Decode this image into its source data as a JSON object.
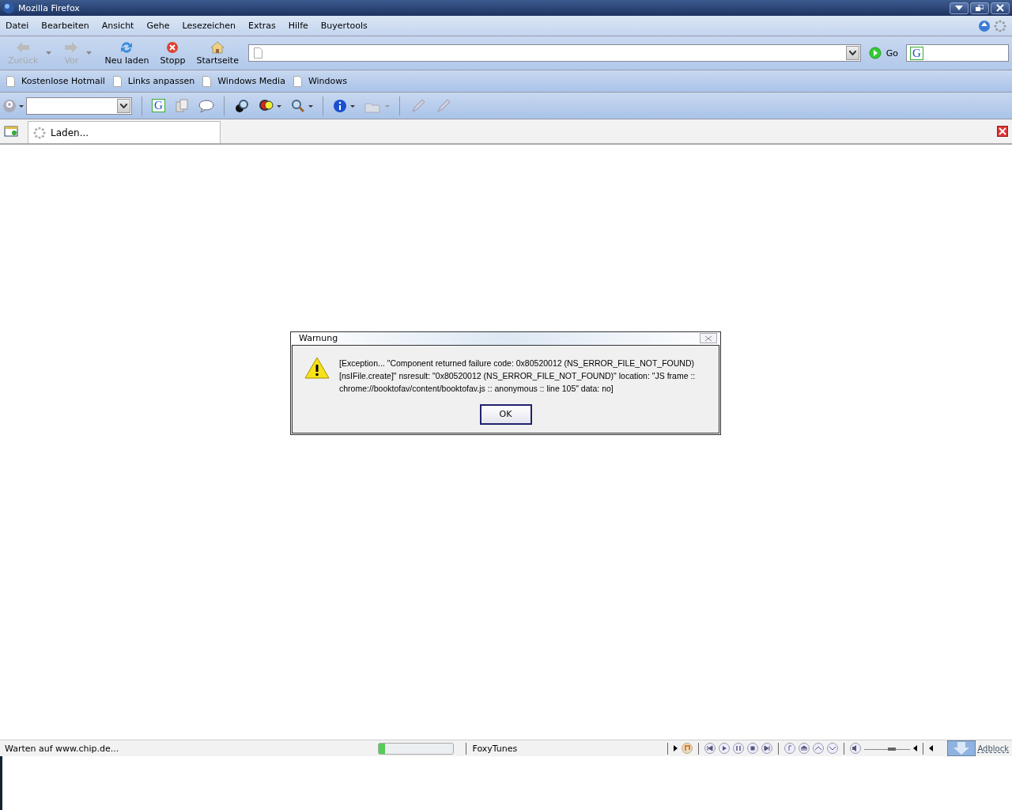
{
  "window": {
    "title": "Mozilla Firefox"
  },
  "menu": [
    "Datei",
    "Bearbeiten",
    "Ansicht",
    "Gehe",
    "Lesezeichen",
    "Extras",
    "Hilfe",
    "Buyertools"
  ],
  "nav_buttons": [
    {
      "label": "Zurück",
      "disabled": true,
      "kind": "back",
      "dropdown": true
    },
    {
      "label": "Vor",
      "disabled": true,
      "kind": "forward",
      "dropdown": true
    },
    {
      "label": "Neu laden",
      "disabled": false,
      "kind": "reload",
      "dropdown": false
    },
    {
      "label": "Stopp",
      "disabled": false,
      "kind": "stop",
      "dropdown": false
    },
    {
      "label": "Startseite",
      "disabled": false,
      "kind": "home",
      "dropdown": false
    }
  ],
  "go_button": "Go",
  "search_engine_label": "G",
  "google_toolbar_engine_label": "G",
  "bookmarks": [
    "Kostenlose Hotmail",
    "Links anpassen",
    "Windows Media",
    "Windows"
  ],
  "tabs": [
    {
      "label": "Laden...",
      "selected": true
    }
  ],
  "dialog": {
    "title": "Warnung",
    "message": "[Exception... \"Component returned failure code: 0x80520012 (NS_ERROR_FILE_NOT_FOUND) [nsIFile.create]\" nsresult: \"0x80520012 (NS_ERROR_FILE_NOT_FOUND)\" location: \"JS frame :: chrome://booktofav/content/booktofav.js :: anonymous :: line 105\" data: no]",
    "button": "OK"
  },
  "status_bar": {
    "text": "Warten auf www.chip.de...",
    "progress": {
      "level": 0.08
    },
    "player": "FoxyTunes",
    "volume": {
      "level": 0.6
    },
    "adblock": "Adblock"
  }
}
